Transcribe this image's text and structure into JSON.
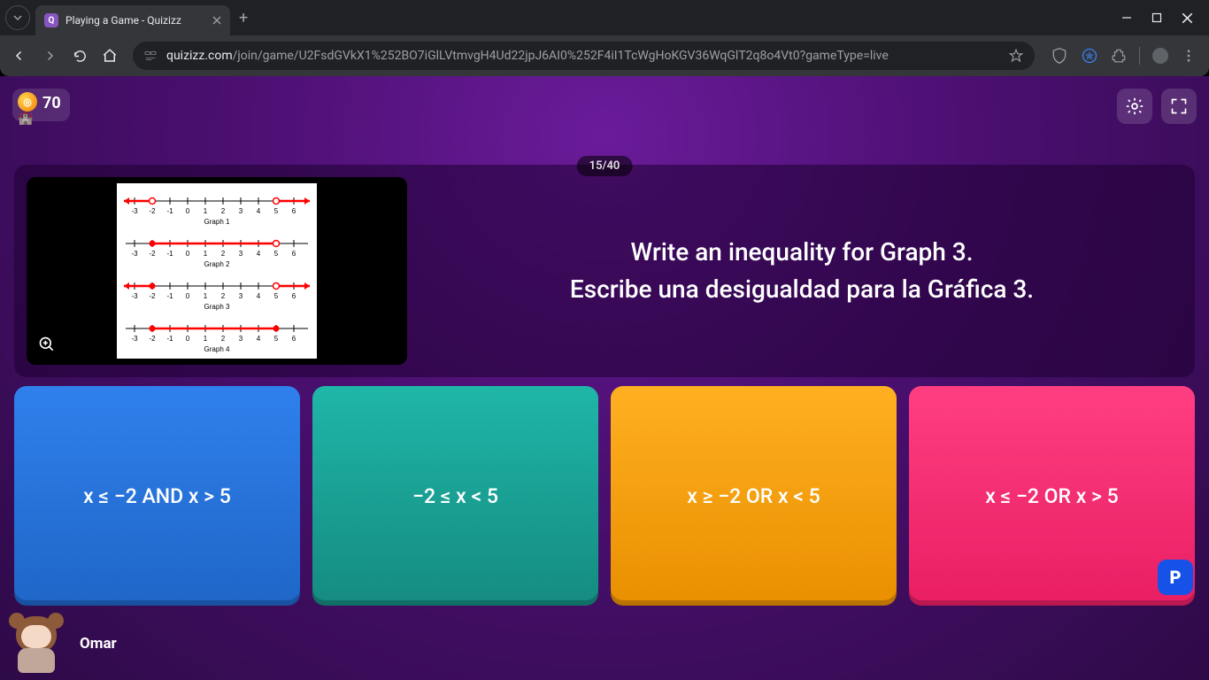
{
  "browser": {
    "tab_title": "Playing a Game - Quizizz",
    "url_display_host": "quizizz.com",
    "url_display_path": "/join/game/U2FsdGVkX1%252BO7iGlLVtmvgH4Ud22jpJ6AI0%252F4iI1TcWgHoKGV36WqGlT2q8o4Vt0?gameType=live"
  },
  "hud": {
    "score": "70",
    "question_counter": "15/40"
  },
  "question": {
    "line1": "Write an inequality for Graph 3.",
    "line2": "Escribe una desigualdad para la Gráfica 3.",
    "image_labels": [
      "Graph 1",
      "Graph 2",
      "Graph 3",
      "Graph 4"
    ],
    "number_line_ticks": [
      "-3",
      "-2",
      "-1",
      "0",
      "1",
      "2",
      "3",
      "4",
      "5",
      "6"
    ]
  },
  "answers": [
    "x ≤ −2 AND x > 5",
    "−2 ≤ x < 5",
    "x ≥ −2 OR x < 5",
    "x ≤ −2 OR x > 5"
  ],
  "player": {
    "name": "Omar"
  },
  "icons": {
    "powerup": "P"
  }
}
